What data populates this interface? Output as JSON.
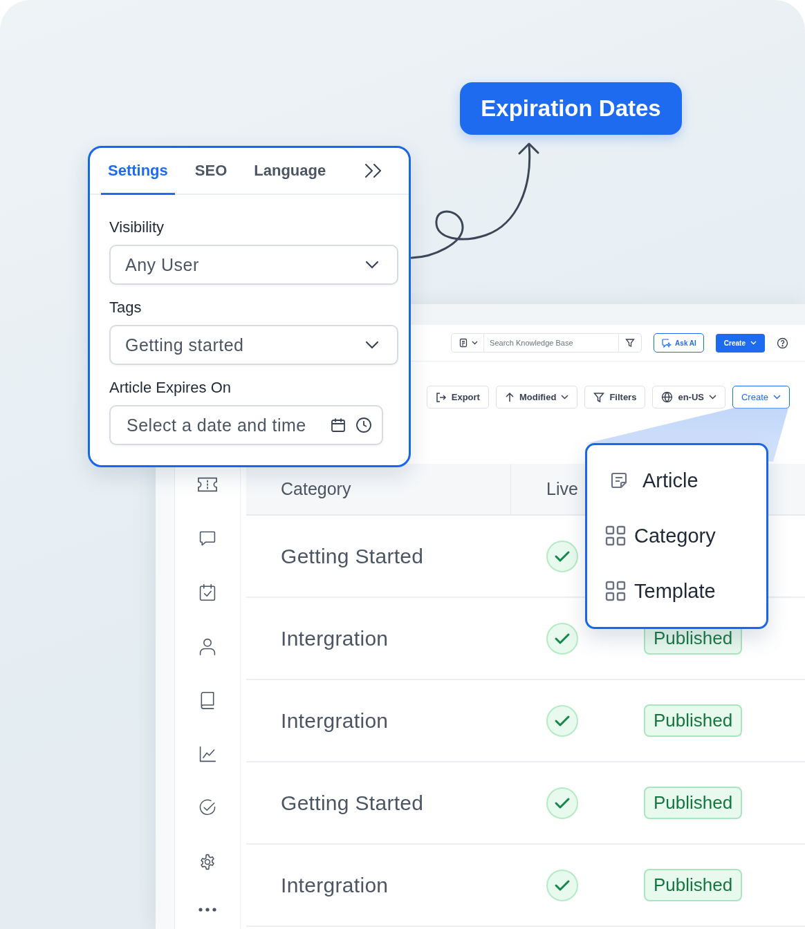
{
  "callout": {
    "label": "Expiration Dates"
  },
  "settings_panel": {
    "tabs": [
      {
        "label": "Settings",
        "selected": true
      },
      {
        "label": "SEO",
        "selected": false
      },
      {
        "label": "Language",
        "selected": false
      }
    ],
    "fields": [
      {
        "kind": "select",
        "label": "Visibility",
        "value": "Any User"
      },
      {
        "kind": "select",
        "label": "Tags",
        "value": "Getting started"
      },
      {
        "kind": "datetime",
        "label": "Article Expires On",
        "placeholder": "Select a date and time"
      }
    ]
  },
  "top_bar": {
    "search": {
      "placeholder": "Search Knowledge Base"
    },
    "ask_ai": "Ask AI",
    "create": "Create"
  },
  "toolbar": {
    "buttons": [
      {
        "kind": "export",
        "label": "Export"
      },
      {
        "kind": "sort",
        "label": "Modified"
      },
      {
        "kind": "filter",
        "label": "Filters"
      },
      {
        "kind": "language",
        "label": "en-US"
      },
      {
        "kind": "create",
        "label": "Create"
      }
    ]
  },
  "table": {
    "columns": [
      "Category",
      "Live"
    ],
    "rows": [
      {
        "category": "Getting Started",
        "live": true
      },
      {
        "category": "Intergration",
        "live": true,
        "status": "Published"
      },
      {
        "category": "Intergration",
        "live": true,
        "status": "Published"
      },
      {
        "category": "Getting Started",
        "live": true,
        "status": "Published"
      },
      {
        "category": "Intergration",
        "live": true,
        "status": "Published"
      }
    ]
  },
  "create_menu": {
    "items": [
      {
        "kind": "article",
        "label": "Article"
      },
      {
        "kind": "grid",
        "label": "Category"
      },
      {
        "kind": "grid",
        "label": "Template"
      }
    ]
  }
}
